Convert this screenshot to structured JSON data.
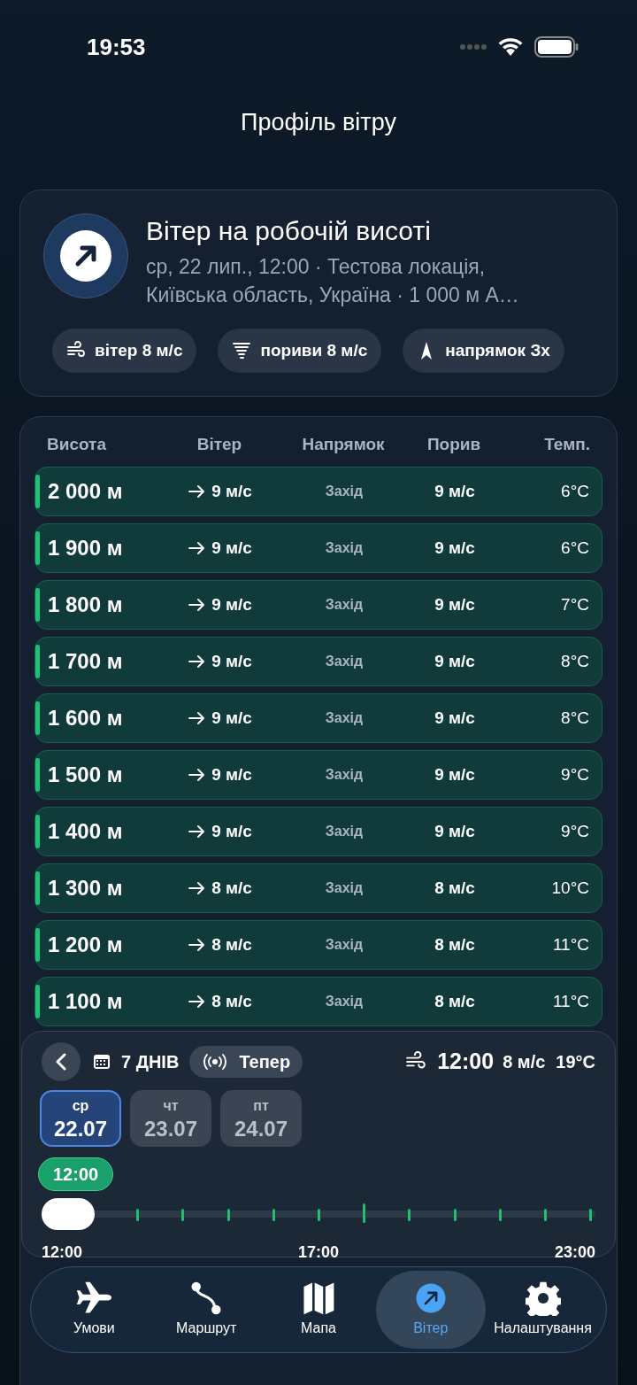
{
  "status_bar": {
    "time": "19:53"
  },
  "header": {
    "title": "Профіль вітру"
  },
  "summary": {
    "title": "Вітер на робочій висоті",
    "subtitle": "ср, 22 лип., 12:00 · Тестова локація, Київська область, Україна · 1 000 м A…",
    "chips": [
      {
        "kind": "wind",
        "label": "вітер 8 м/с"
      },
      {
        "kind": "gust",
        "label": "пориви 8 м/с"
      },
      {
        "kind": "direction",
        "label": "напрямок Зх"
      }
    ]
  },
  "table": {
    "columns": [
      "Висота",
      "Вітер",
      "Напрямок",
      "Порив",
      "Темп."
    ],
    "rows": [
      {
        "height": "2 000 м",
        "wind": "9 м/с",
        "direction": "Захід",
        "gust": "9 м/с",
        "temp": "6°C"
      },
      {
        "height": "1 900 м",
        "wind": "9 м/с",
        "direction": "Захід",
        "gust": "9 м/с",
        "temp": "6°C"
      },
      {
        "height": "1 800 м",
        "wind": "9 м/с",
        "direction": "Захід",
        "gust": "9 м/с",
        "temp": "7°C"
      },
      {
        "height": "1 700 м",
        "wind": "9 м/с",
        "direction": "Захід",
        "gust": "9 м/с",
        "temp": "8°C"
      },
      {
        "height": "1 600 м",
        "wind": "9 м/с",
        "direction": "Захід",
        "gust": "9 м/с",
        "temp": "8°C"
      },
      {
        "height": "1 500 м",
        "wind": "9 м/с",
        "direction": "Захід",
        "gust": "9 м/с",
        "temp": "9°C"
      },
      {
        "height": "1 400 м",
        "wind": "9 м/с",
        "direction": "Захід",
        "gust": "9 м/с",
        "temp": "9°C"
      },
      {
        "height": "1 300 м",
        "wind": "8 м/с",
        "direction": "Захід",
        "gust": "8 м/с",
        "temp": "10°C"
      },
      {
        "height": "1 200 м",
        "wind": "8 м/с",
        "direction": "Захід",
        "gust": "8 м/с",
        "temp": "11°C"
      },
      {
        "height": "1 100 м",
        "wind": "8 м/с",
        "direction": "Захід",
        "gust": "8 м/с",
        "temp": "11°C"
      }
    ]
  },
  "timeline": {
    "range_label": "7 ДНІВ",
    "now_button": "Тепер",
    "current": {
      "time": "12:00",
      "wind": "8 м/с",
      "temp": "19°C"
    },
    "days": [
      {
        "weekday": "ср",
        "date": "22.07",
        "selected": true
      },
      {
        "weekday": "чт",
        "date": "23.07",
        "selected": false
      },
      {
        "weekday": "пт",
        "date": "24.07",
        "selected": false
      }
    ],
    "time_badge": "12:00",
    "slider": {
      "level": 0
    },
    "tick_labels": [
      "12:00",
      "17:00",
      "23:00"
    ]
  },
  "tab_bar": {
    "items": [
      {
        "kind": "conditions",
        "label": "Умови",
        "selected": false
      },
      {
        "kind": "route",
        "label": "Маршрут",
        "selected": false
      },
      {
        "kind": "map",
        "label": "Мапа",
        "selected": false
      },
      {
        "kind": "wind",
        "label": "Вітер",
        "selected": true
      },
      {
        "kind": "settings",
        "label": "Налаштування",
        "selected": false
      }
    ]
  }
}
